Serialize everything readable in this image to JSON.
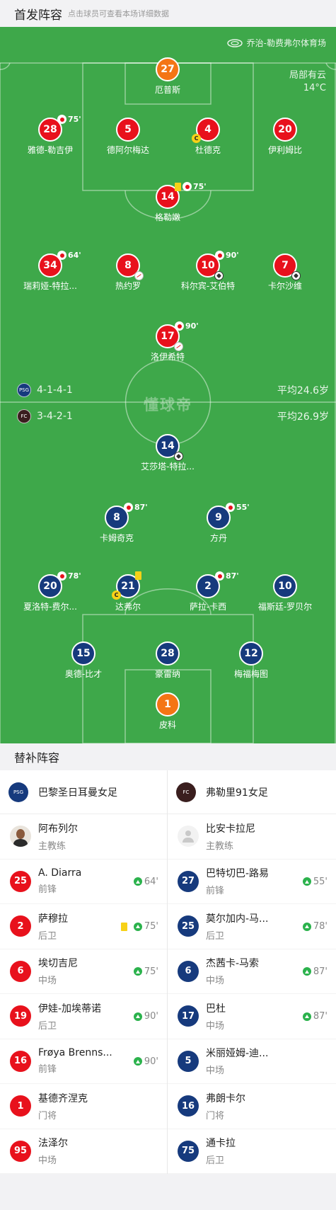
{
  "header": {
    "title": "首发阵容",
    "hint": "点击球员可查看本场详细数据"
  },
  "venue": {
    "name": "乔治-勒费弗尔体育场",
    "icon": "stadium-icon"
  },
  "weather": {
    "condition": "局部有云",
    "temp": "14°C"
  },
  "watermark": "懂球帝",
  "home": {
    "name": "巴黎圣日耳曼女足",
    "formation": "4-1-4-1",
    "avg_age": "平均24.6岁",
    "color": "#163a7d"
  },
  "away": {
    "name": "弗勒里91女足",
    "formation": "3-4-2-1",
    "avg_age": "平均26.9岁",
    "color": "#e8111c"
  },
  "lineup": {
    "p1": {
      "num": "27",
      "name": "厄普斯"
    },
    "p2": {
      "num": "28",
      "name": "雅德-勒吉伊",
      "sub": "75'"
    },
    "p3": {
      "num": "5",
      "name": "德阿尔梅达"
    },
    "p4": {
      "num": "4",
      "name": "杜德克"
    },
    "p5": {
      "num": "20",
      "name": "伊利姆比"
    },
    "p6": {
      "num": "14",
      "name": "格勒嫩",
      "sub": "75'"
    },
    "p7": {
      "num": "34",
      "name": "瑞莉娅-特拉...",
      "sub": "64'"
    },
    "p8": {
      "num": "8",
      "name": "热约罗"
    },
    "p9": {
      "num": "10",
      "name": "科尔宾-艾伯特",
      "sub": "90'"
    },
    "p10": {
      "num": "7",
      "name": "卡尔沙维"
    },
    "p11": {
      "num": "17",
      "name": "洛伊希特",
      "sub": "90'"
    },
    "q1": {
      "num": "14",
      "name": "艾莎塔-特拉..."
    },
    "q2": {
      "num": "8",
      "name": "卡姆奇克",
      "sub": "87'"
    },
    "q3": {
      "num": "9",
      "name": "方丹",
      "sub": "55'"
    },
    "q4": {
      "num": "20",
      "name": "夏洛特-费尔...",
      "sub": "78'"
    },
    "q5": {
      "num": "21",
      "name": "达弗尔"
    },
    "q6": {
      "num": "2",
      "name": "萨拉-卡西",
      "sub": "87'"
    },
    "q7": {
      "num": "10",
      "name": "福斯廷-罗贝尔"
    },
    "q8": {
      "num": "15",
      "name": "奥德-比才"
    },
    "q9": {
      "num": "28",
      "name": "豪雷纳"
    },
    "q10": {
      "num": "12",
      "name": "梅福梅图"
    },
    "q11": {
      "num": "1",
      "name": "皮科"
    }
  },
  "captain_mark": "C",
  "subs_title": "替补阵容",
  "subs": {
    "home": {
      "coach": {
        "name": "阿布列尔",
        "role": "主教练"
      },
      "players": [
        {
          "num": "25",
          "name": "A. Diarra",
          "pos": "前锋",
          "in": "64'"
        },
        {
          "num": "2",
          "name": "萨穆拉",
          "pos": "后卫",
          "in": "75'"
        },
        {
          "num": "6",
          "name": "埃切吉尼",
          "pos": "中场",
          "in": "75'"
        },
        {
          "num": "19",
          "name": "伊娃-加埃蒂诺",
          "pos": "后卫",
          "in": "90'"
        },
        {
          "num": "16",
          "name": "Frøya Brenns...",
          "pos": "前锋",
          "in": "90'"
        },
        {
          "num": "1",
          "name": "基德齐涅克",
          "pos": "门将",
          "in": ""
        },
        {
          "num": "95",
          "name": "法泽尔",
          "pos": "中场",
          "in": ""
        }
      ]
    },
    "away": {
      "coach": {
        "name": "比安卡拉尼",
        "role": "主教练"
      },
      "players": [
        {
          "num": "27",
          "name": "巴特切巴-路易",
          "pos": "前锋",
          "in": "55'"
        },
        {
          "num": "25",
          "name": "莫尔加内-马...",
          "pos": "后卫",
          "in": "78'"
        },
        {
          "num": "6",
          "name": "杰茜卡-马索",
          "pos": "中场",
          "in": "87'"
        },
        {
          "num": "17",
          "name": "巴杜",
          "pos": "中场",
          "in": "87'"
        },
        {
          "num": "5",
          "name": "米丽娅姆-迪...",
          "pos": "中场",
          "in": ""
        },
        {
          "num": "16",
          "name": "弗朗卡尔",
          "pos": "门将",
          "in": ""
        },
        {
          "num": "75",
          "name": "通卡拉",
          "pos": "后卫",
          "in": ""
        }
      ]
    }
  }
}
